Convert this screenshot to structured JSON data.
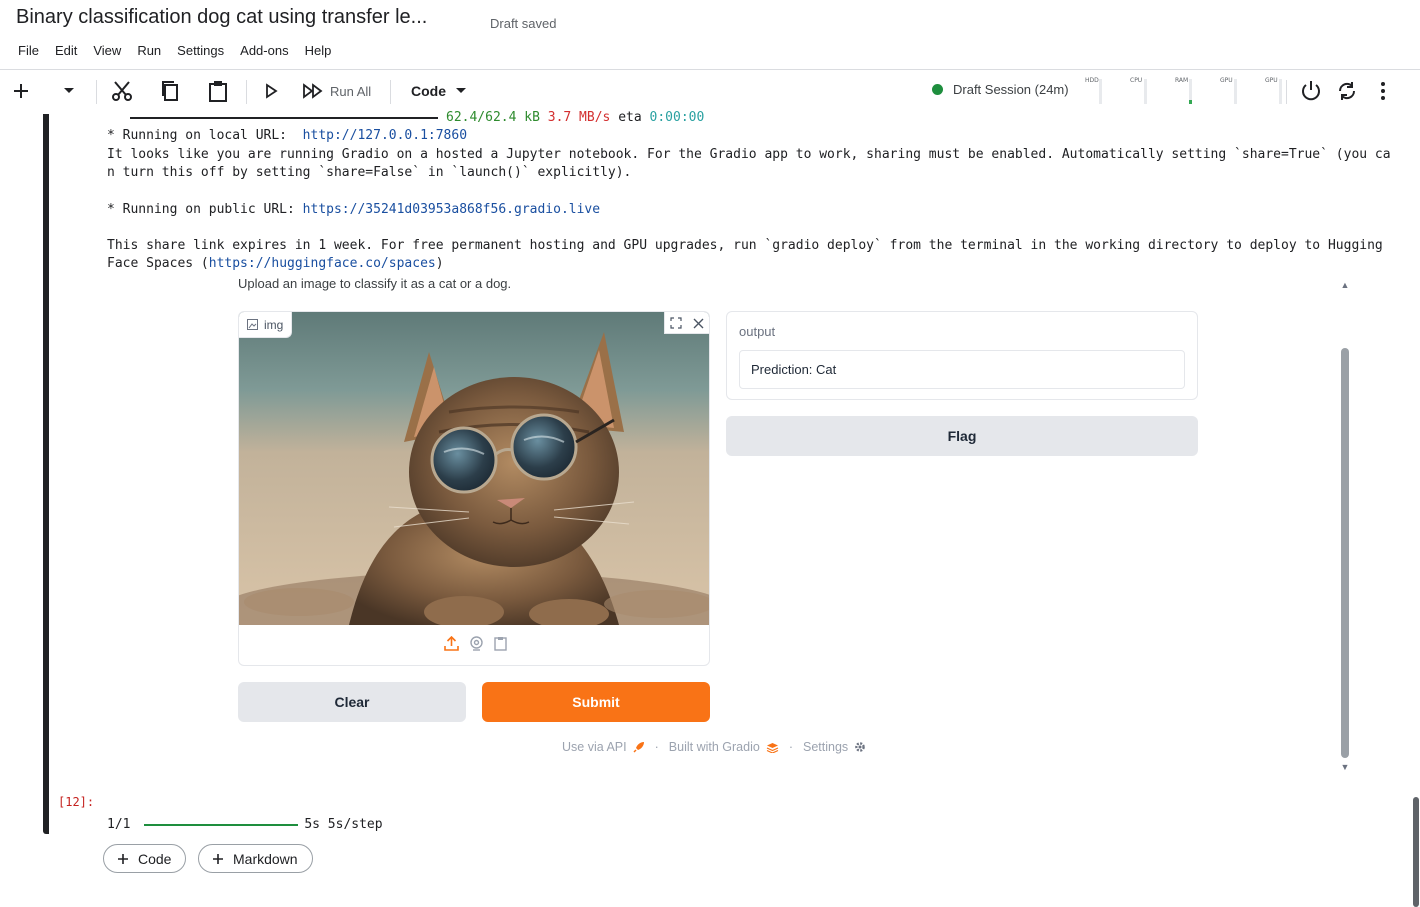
{
  "header": {
    "title": "Binary classification dog cat using transfer le...",
    "status": "Draft saved",
    "menu": [
      "File",
      "Edit",
      "View",
      "Run",
      "Settings",
      "Add-ons",
      "Help"
    ]
  },
  "toolbar": {
    "run_all_label": "Run All",
    "cell_type": "Code",
    "session_label": "Draft Session (24m)",
    "meters": [
      {
        "label": "HDD",
        "level": 0.0
      },
      {
        "label": "CPU",
        "level": 0.0
      },
      {
        "label": "RAM",
        "level": 0.15
      },
      {
        "label": "GPU",
        "level": 0.0
      },
      {
        "label": "GPU",
        "level": 0.0
      }
    ]
  },
  "output": {
    "progress_size": "62.4/62.4 kB",
    "progress_speed": "3.7 MB/s",
    "progress_eta_label": "eta",
    "progress_eta": "0:00:00",
    "local_prefix": "* Running on local URL:  ",
    "local_url": "http://127.0.0.1:7860",
    "share_line_1": "It looks like you are running Gradio on a hosted a Jupyter notebook. For the Gradio app to work, sharing must be enabled. Automatically setting `share=True` (you ca",
    "share_line_2": "n turn this off by setting `share=False` in `launch()` explicitly).",
    "public_prefix": "* Running on public URL: ",
    "public_url": "https://35241d03953a868f56.gradio.live",
    "expires_line_1": "This share link expires in 1 week. For free permanent hosting and GPU upgrades, run `gradio deploy` from the terminal in the working directory to deploy to Hugging",
    "expires_prefix_2": "Face Spaces (",
    "expires_url": "https://huggingface.co/spaces",
    "expires_suffix_2": ")"
  },
  "gradio": {
    "description": "Upload an image to classify it as a cat or a dog.",
    "image_label": "img",
    "output_label": "output",
    "prediction": "Prediction: Cat",
    "flag_label": "Flag",
    "clear_label": "Clear",
    "submit_label": "Submit",
    "footer_api": "Use via API",
    "footer_built": "Built with Gradio",
    "footer_settings": "Settings",
    "footer_sep": "·"
  },
  "cell2": {
    "exec_count": "[12]:",
    "step_count": "1/1",
    "step_time": "5s 5s/step"
  },
  "add_cell": {
    "code_label": "Code",
    "markdown_label": "Markdown"
  },
  "colors": {
    "submit": "#f97316",
    "session_dot": "#1e8e3e",
    "url_link": "#1a4fa0"
  },
  "icons": [
    "add-icon",
    "chevron-down-icon",
    "scissors-icon",
    "copy-icon",
    "paste-icon",
    "run-icon",
    "run-all-icon",
    "power-icon",
    "refresh-icon",
    "more-icon",
    "image-icon",
    "fullscreen-icon",
    "close-icon",
    "upload-icon",
    "webcam-icon",
    "clipboard-icon",
    "rocket-icon",
    "gradio-logo-icon",
    "gear-icon"
  ]
}
